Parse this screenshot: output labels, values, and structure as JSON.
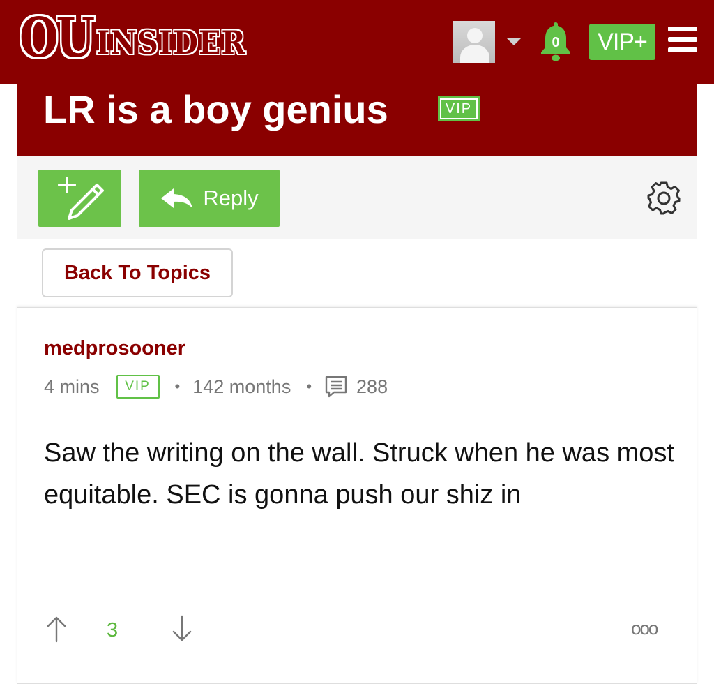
{
  "header": {
    "logo": {
      "primary": "OU",
      "secondary": "INSIDER"
    },
    "notification_count": "0",
    "vip_plus_label": "VIP+"
  },
  "topic": {
    "title": "LR is a boy genius",
    "badge": "VIP"
  },
  "actions": {
    "reply_label": "Reply",
    "back_label": "Back To Topics"
  },
  "post": {
    "author": "medprosooner",
    "time": "4 mins",
    "badge": "VIP",
    "membership": "142 months",
    "post_count": "288",
    "body": "Saw the writing on the wall. Struck when he was most equitable. SEC is gonna push our shiz in",
    "votes": "3"
  },
  "colors": {
    "brand_crimson": "#8a0000",
    "action_green": "#6cc24a",
    "badge_green": "#61c147",
    "muted_text": "#777777"
  },
  "icons": [
    "avatar",
    "chevron-down-icon",
    "bell-icon",
    "menu-icon",
    "new-post-icon",
    "reply-arrow-icon",
    "gear-icon",
    "message-icon",
    "arrow-up-icon",
    "arrow-down-icon",
    "more-icon"
  ]
}
